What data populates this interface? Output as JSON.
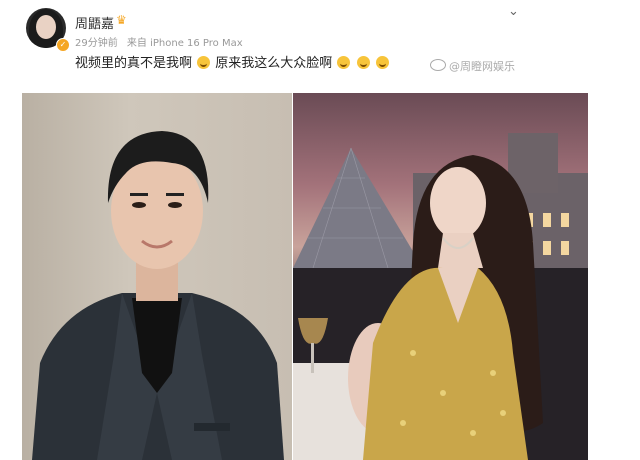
{
  "post": {
    "username": "周鼯嘉",
    "time": "29分钟前",
    "source": "来自 iPhone 16 Pro Max",
    "text_part1": "视频里的真不是我啊",
    "text_part2": "原来我这么大众脸啊",
    "watermark": "@周瞪网娱乐"
  },
  "images": [
    {
      "description": "man-portrait"
    },
    {
      "description": "woman-louvre"
    }
  ]
}
